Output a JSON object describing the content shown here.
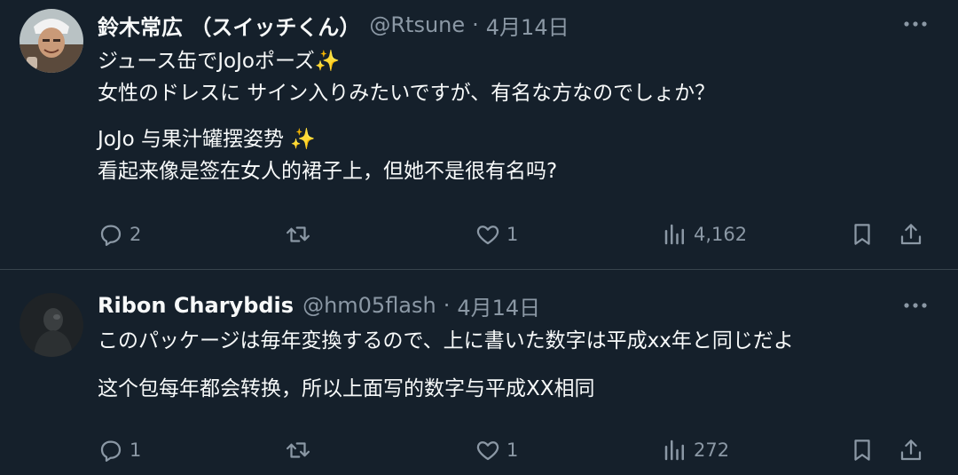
{
  "posts": [
    {
      "author_name": "鈴木常広 （スイッチくん）",
      "handle": "@Rtsune",
      "separator": "·",
      "date": "4月14日",
      "text_lines": [
        "ジュース缶でJoJoポーズ✨",
        "女性のドレスに サイン入りみたいですが、有名な方なのでしょか？"
      ],
      "translation_lines": [
        "JoJo 与果汁罐摆姿势 ✨",
        "看起来像是签在女人的裙子上，但她不是很有名吗?"
      ],
      "replies": "2",
      "reposts": "",
      "likes": "1",
      "views": "4,162"
    },
    {
      "author_name": "Ribon Charybdis",
      "handle": "@hm05flash",
      "separator": "·",
      "date": "4月14日",
      "text_lines": [
        "このパッケージは毎年変換するので、上に書いた数字は平成xx年と同じだよ"
      ],
      "translation_lines": [
        "这个包每年都会转换，所以上面写的数字与平成XX相同"
      ],
      "replies": "1",
      "reposts": "",
      "likes": "1",
      "views": "272"
    }
  ],
  "colors": {
    "background": "#15202b",
    "text": "#f7f9f9",
    "muted": "#8b98a5",
    "divider": "#38444d"
  },
  "icons": [
    "more-icon",
    "reply-icon",
    "repost-icon",
    "like-icon",
    "views-icon",
    "bookmark-icon",
    "share-icon"
  ]
}
